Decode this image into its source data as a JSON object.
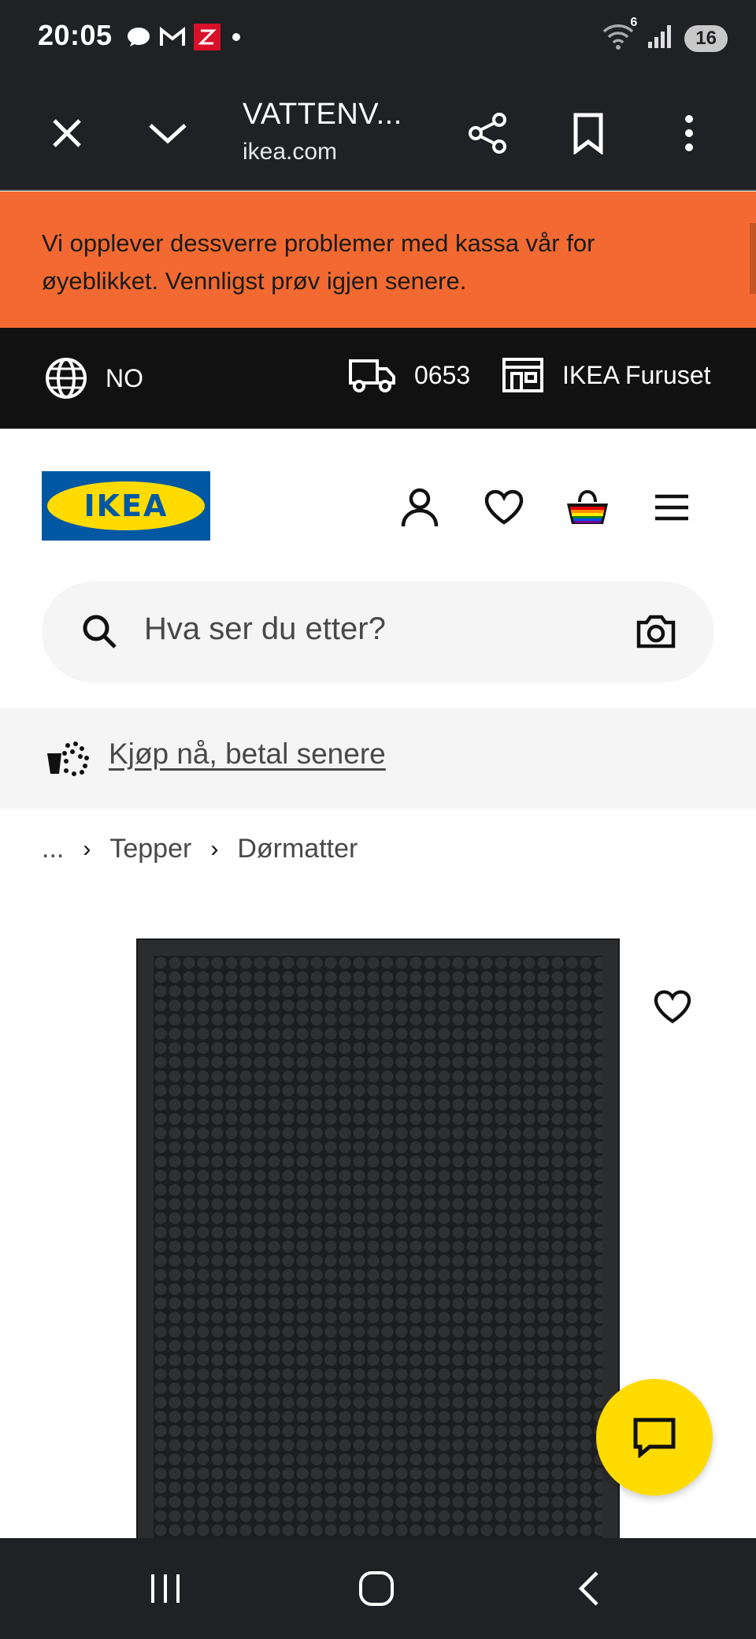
{
  "status_bar": {
    "time": "20:05",
    "notification_icons": [
      "chat-bubble-icon",
      "gmail-icon",
      "app-z-icon",
      "dot-icon"
    ],
    "right_icons": [
      "wifi-icon",
      "signal-icon"
    ],
    "wifi_label": "6",
    "battery": "16"
  },
  "browser": {
    "title": "VATTENV...",
    "url": "ikea.com"
  },
  "alert": {
    "text": "Vi opplever dessverre problemer med kassa vår for øyeblikket. Vennligst prøv igjen senere."
  },
  "infobar": {
    "language": "NO",
    "postcode": "0653",
    "store": "IKEA Furuset"
  },
  "header": {
    "logo_text": "IKEA"
  },
  "search": {
    "placeholder": "Hva ser du etter?"
  },
  "promo": {
    "text": "Kjøp nå, betal senere"
  },
  "breadcrumb": {
    "items": [
      "...",
      "Tepper",
      "Dørmatter"
    ]
  },
  "colors": {
    "alert_bg": "#f26a31",
    "ikea_blue": "#0058a3",
    "ikea_yellow": "#ffdb00",
    "dark_bar": "#202124"
  }
}
